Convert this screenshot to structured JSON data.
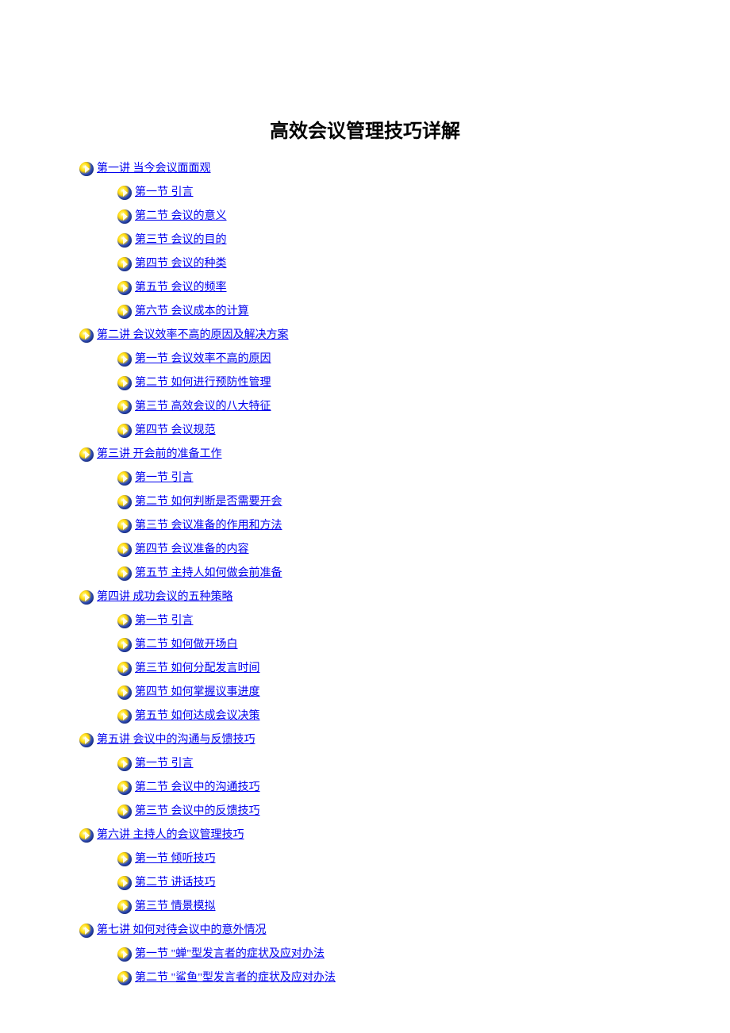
{
  "title": "高效会议管理技巧详解",
  "toc": [
    {
      "level": 0,
      "label": "第一讲  当今会议面面观"
    },
    {
      "level": 1,
      "label": "第一节  引言"
    },
    {
      "level": 1,
      "label": "第二节  会议的意义"
    },
    {
      "level": 1,
      "label": "第三节  会议的目的"
    },
    {
      "level": 1,
      "label": "第四节  会议的种类"
    },
    {
      "level": 1,
      "label": "第五节  会议的频率"
    },
    {
      "level": 1,
      "label": "第六节  会议成本的计算"
    },
    {
      "level": 0,
      "label": "第二讲  会议效率不高的原因及解决方案"
    },
    {
      "level": 1,
      "label": "第一节  会议效率不高的原因"
    },
    {
      "level": 1,
      "label": "第二节  如何进行预防性管理"
    },
    {
      "level": 1,
      "label": "第三节  高效会议的八大特征"
    },
    {
      "level": 1,
      "label": "第四节  会议规范"
    },
    {
      "level": 0,
      "label": "第三讲  开会前的准备工作"
    },
    {
      "level": 1,
      "label": "第一节  引言"
    },
    {
      "level": 1,
      "label": "第二节  如何判断是否需要开会"
    },
    {
      "level": 1,
      "label": "第三节  会议准备的作用和方法"
    },
    {
      "level": 1,
      "label": "第四节  会议准备的内容"
    },
    {
      "level": 1,
      "label": "第五节  主持人如何做会前准备"
    },
    {
      "level": 0,
      "label": "第四讲  成功会议的五种策略"
    },
    {
      "level": 1,
      "label": "第一节  引言"
    },
    {
      "level": 1,
      "label": "第二节  如何做开场白"
    },
    {
      "level": 1,
      "label": "第三节  如何分配发言时间"
    },
    {
      "level": 1,
      "label": "第四节  如何掌握议事进度"
    },
    {
      "level": 1,
      "label": "第五节  如何达成会议决策"
    },
    {
      "level": 0,
      "label": "第五讲  会议中的沟通与反馈技巧"
    },
    {
      "level": 1,
      "label": "第一节  引言"
    },
    {
      "level": 1,
      "label": "第二节  会议中的沟通技巧"
    },
    {
      "level": 1,
      "label": "第三节  会议中的反馈技巧"
    },
    {
      "level": 0,
      "label": "第六讲  主持人的会议管理技巧"
    },
    {
      "level": 1,
      "label": "第一节  倾听技巧"
    },
    {
      "level": 1,
      "label": "第二节  讲话技巧"
    },
    {
      "level": 1,
      "label": "第三节  情景模拟"
    },
    {
      "level": 0,
      "label": "第七讲  如何对待会议中的意外情况"
    },
    {
      "level": 1,
      "label": "第一节  \"蝉\"型发言者的症状及应对办法"
    },
    {
      "level": 1,
      "label": "第二节  \"鲨鱼\"型发言者的症状及应对办法"
    }
  ]
}
